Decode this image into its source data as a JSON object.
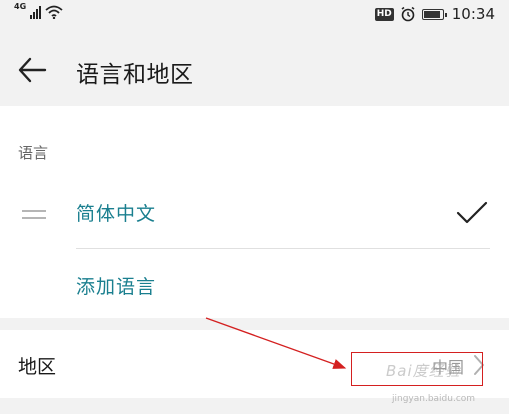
{
  "status_bar": {
    "network": "4G",
    "hd": "HD",
    "time": "10:34",
    "icons": [
      "signal-icon",
      "wifi-icon",
      "hd-icon",
      "alarm-icon",
      "battery-icon"
    ]
  },
  "app_bar": {
    "back_icon": "arrow-left-icon",
    "title": "语言和地区"
  },
  "language_section": {
    "header": "语言",
    "items": [
      {
        "label": "简体中文",
        "selected": true,
        "icon": "check-icon"
      }
    ],
    "add_label": "添加语言"
  },
  "region": {
    "label": "地区",
    "value": "中国",
    "icon": "chevron-right-icon"
  },
  "annotation": {
    "color": "#d42020"
  },
  "watermark": {
    "text": "Bai度经验",
    "sub": "jingyan.baidu.com"
  },
  "colors": {
    "accent": "#1a7f8f",
    "background": "#f2f2f2",
    "card": "#ffffff"
  }
}
